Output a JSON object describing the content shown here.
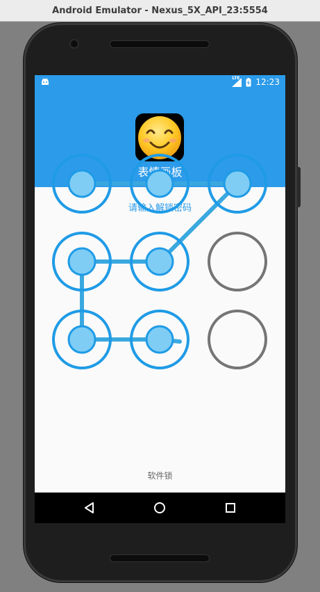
{
  "window": {
    "title": "Android Emulator - Nexus_5X_API_23:5554"
  },
  "status_bar": {
    "network": "LTE",
    "time": "12:23",
    "icon_left": "android-debug-icon"
  },
  "app": {
    "icon": "smiling-face-emoji-icon",
    "title": "表情画板"
  },
  "lock": {
    "prompt": "请输入解锁密码",
    "footer_label": "软件锁",
    "grid": {
      "rows": 3,
      "cols": 3
    },
    "selected_nodes": [
      1,
      2,
      3,
      5,
      4,
      7,
      8
    ],
    "unselected_nodes": [
      6,
      9
    ]
  },
  "nav_bar": {
    "back": "back-icon",
    "home": "home-icon",
    "recents": "recents-icon"
  },
  "colors": {
    "accent": "#2c9bea",
    "node_ring": "#1f9be6",
    "node_fill": "#7fcdf5",
    "line": "#3aa8df",
    "idle_ring": "#757575"
  }
}
